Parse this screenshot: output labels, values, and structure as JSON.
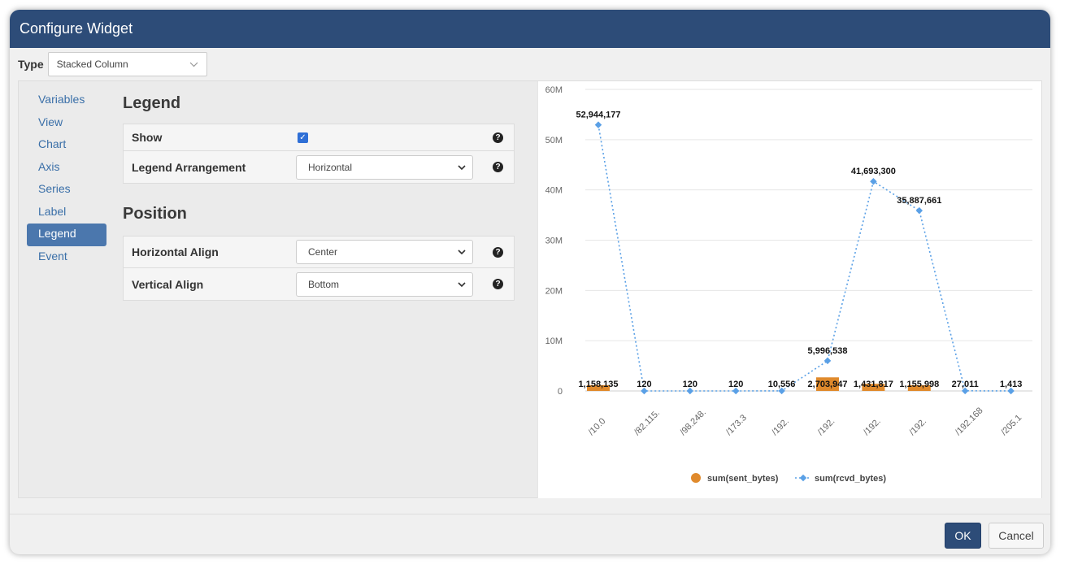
{
  "dialog": {
    "title": "Configure Widget"
  },
  "type_field": {
    "label": "Type",
    "value": "Stacked Column"
  },
  "nav": {
    "items": [
      "Variables",
      "View",
      "Chart",
      "Axis",
      "Series",
      "Label",
      "Legend",
      "Event"
    ],
    "active": "Legend"
  },
  "legend_section": {
    "title": "Legend",
    "show_label": "Show",
    "show_checked": true,
    "arrangement_label": "Legend Arrangement",
    "arrangement_value": "Horizontal"
  },
  "position_section": {
    "title": "Position",
    "horizontal_label": "Horizontal Align",
    "horizontal_value": "Center",
    "vertical_label": "Vertical Align",
    "vertical_value": "Bottom"
  },
  "chart_data": {
    "type": "bar",
    "y_ticks": [
      "0",
      "10M",
      "20M",
      "30M",
      "40M",
      "50M",
      "60M"
    ],
    "ylim": [
      0,
      60000000
    ],
    "categories": [
      "/10.0",
      "/82.115.",
      "/98.248.",
      "/173.3",
      "/192.",
      "/192.",
      "/192.",
      "/192.",
      "/192.168",
      "/205.1"
    ],
    "series": [
      {
        "name": "sum(sent_bytes)",
        "kind": "bar",
        "color": "#e08a2c",
        "values": [
          1158135,
          0,
          0,
          0,
          0,
          2703947,
          1431817,
          1155998,
          0,
          0
        ],
        "labels": [
          "1,158,135",
          "",
          "",
          "",
          "",
          "2,703,947",
          "1,431,817",
          "1,155,998",
          "",
          ""
        ]
      },
      {
        "name": "sum(rcvd_bytes)",
        "kind": "line",
        "color": "#5aa0e6",
        "values": [
          52944177,
          120,
          120,
          120,
          10556,
          5996538,
          41693300,
          35887661,
          27011,
          1413
        ],
        "labels": [
          "52,944,177",
          "120",
          "120",
          "120",
          "10,556",
          "5,996,538",
          "41,693,300",
          "35,887,661",
          "27,011",
          "1,413"
        ]
      }
    ],
    "legend_position": "bottom-center",
    "grid": true
  },
  "footer": {
    "ok_label": "OK",
    "cancel_label": "Cancel"
  }
}
